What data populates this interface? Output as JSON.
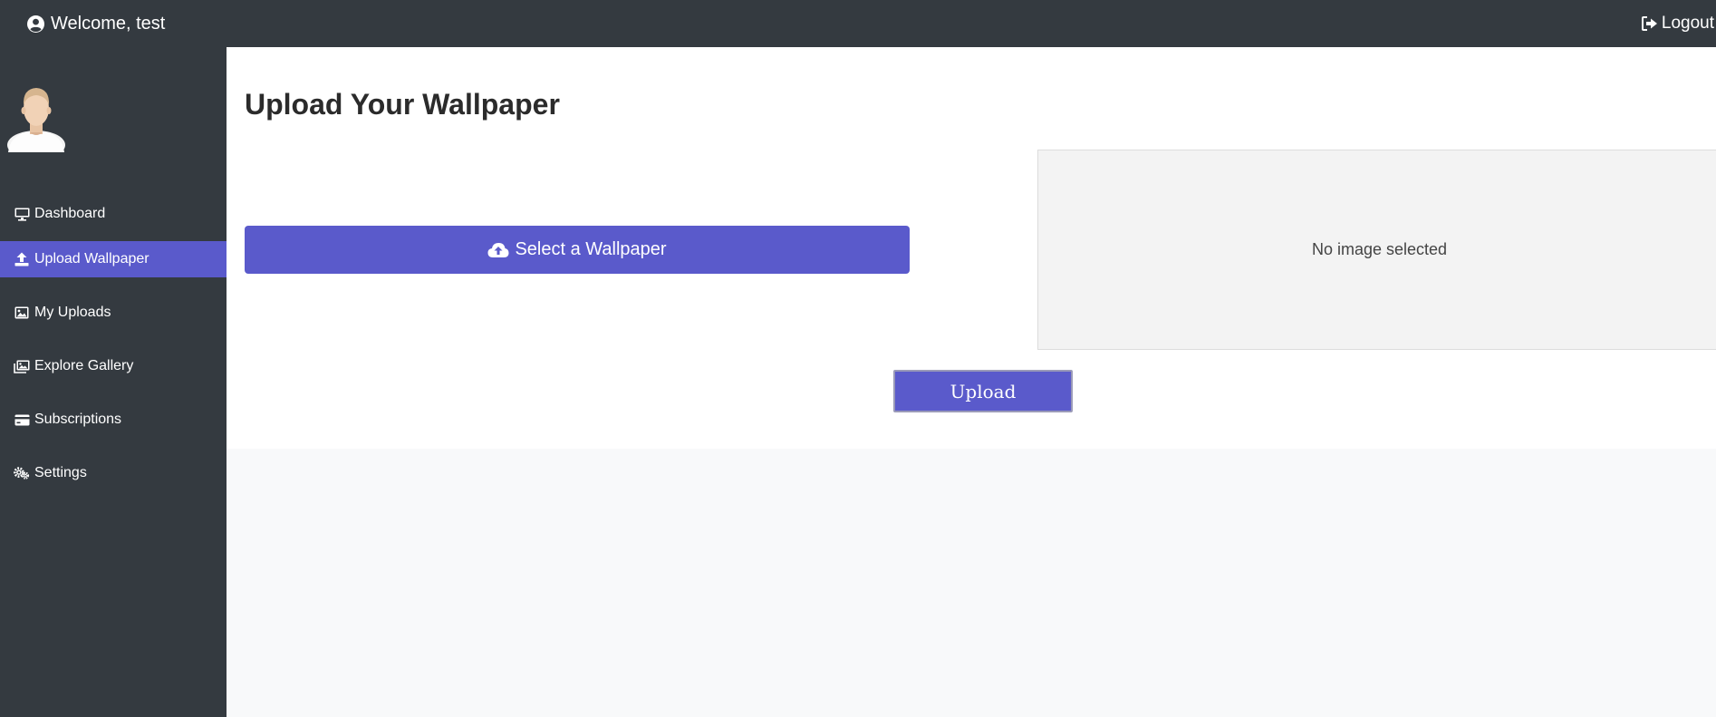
{
  "header": {
    "welcome_text": "Welcome, test",
    "logout_label": "Logout",
    "user_icon": "user-circle-icon",
    "logout_icon": "sign-out-icon"
  },
  "sidebar": {
    "items": [
      {
        "label": "Dashboard",
        "icon": "desktop-icon",
        "active": false
      },
      {
        "label": "Upload Wallpaper",
        "icon": "upload-icon",
        "active": true
      },
      {
        "label": "My Uploads",
        "icon": "image-icon",
        "active": false
      },
      {
        "label": "Explore Gallery",
        "icon": "images-icon",
        "active": false
      },
      {
        "label": "Subscriptions",
        "icon": "credit-card-icon",
        "active": false
      },
      {
        "label": "Settings",
        "icon": "gears-icon",
        "active": false
      }
    ]
  },
  "main": {
    "title": "Upload Your Wallpaper",
    "select_button_label": "Select a Wallpaper",
    "preview_placeholder": "No image selected",
    "upload_button_label": "Upload"
  },
  "colors": {
    "dark": "#343a40",
    "accent": "#5a5acb",
    "page_bg": "#f8f9fa"
  }
}
